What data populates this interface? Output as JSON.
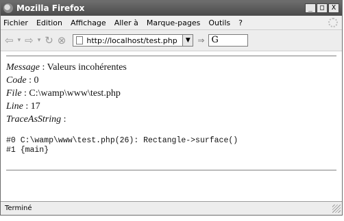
{
  "window": {
    "title": "Mozilla Firefox",
    "minimize": "_",
    "maximize": "□",
    "close": "X"
  },
  "menu": [
    {
      "label": "Fichier"
    },
    {
      "label": "Edition"
    },
    {
      "label": "Affichage"
    },
    {
      "label": "Aller à"
    },
    {
      "label": "Marque-pages"
    },
    {
      "label": "Outils"
    },
    {
      "label": "?"
    }
  ],
  "nav": {
    "back": "⇦",
    "forward": "⇨",
    "reload": "↻",
    "stop": "⊗",
    "url": "http://localhost/test.php",
    "search_glyph": "G"
  },
  "page": {
    "message_label": "Message",
    "message_value": " : Valeurs incohérentes",
    "code_label": "Code",
    "code_value": " : 0",
    "file_label": "File",
    "file_value": " : C:\\wamp\\www\\test.php",
    "line_label": "Line",
    "line_value": " : 17",
    "trace_label": "TraceAsString",
    "trace_value": " :",
    "trace_lines": [
      "#0 C:\\wamp\\www\\test.php(26): Rectangle->surface()",
      "#1 {main}"
    ]
  },
  "status": {
    "text": "Terminé"
  }
}
